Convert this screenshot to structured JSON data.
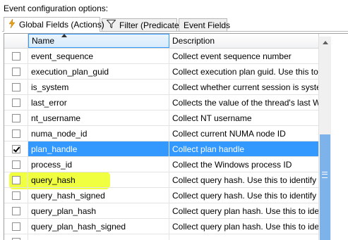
{
  "caption": "Event configuration options:",
  "tabs": [
    {
      "label": "Global Fields (Actions)",
      "icon": "lightning-icon",
      "active": true
    },
    {
      "label": "Filter (Predicate)",
      "icon": "funnel-icon",
      "active": false
    },
    {
      "label": "Event Fields",
      "icon": "",
      "active": false
    }
  ],
  "grid": {
    "columns": {
      "name": "Name",
      "description": "Description"
    },
    "rows": [
      {
        "name": "event_sequence",
        "description": "Collect event sequence number",
        "checked": false
      },
      {
        "name": "execution_plan_guid",
        "description": "Collect execution plan guid. Use this to uniqu",
        "checked": false
      },
      {
        "name": "is_system",
        "description": "Collect whether current session is system",
        "checked": false
      },
      {
        "name": "last_error",
        "description": "Collects the value of the thread's last Windo",
        "checked": false
      },
      {
        "name": "nt_username",
        "description": "Collect NT username",
        "checked": false
      },
      {
        "name": "numa_node_id",
        "description": "Collect current NUMA node ID",
        "checked": false
      },
      {
        "name": "plan_handle",
        "description": "Collect plan handle",
        "checked": true
      },
      {
        "name": "process_id",
        "description": "Collect the Windows process ID",
        "checked": false
      },
      {
        "name": "query_hash",
        "description": "Collect query hash. Use this to identify querie",
        "checked": false
      },
      {
        "name": "query_hash_signed",
        "description": "Collect query hash. Use this to identify querie",
        "checked": false
      },
      {
        "name": "query_plan_hash",
        "description": "Collect query plan hash. Use this to identify s",
        "checked": false
      },
      {
        "name": "query_plan_hash_signed",
        "description": "Collect query plan hash. Use this to identify s",
        "checked": false
      },
      {
        "name": "",
        "description": "",
        "checked": false
      }
    ]
  },
  "colors": {
    "selection": "#3399ff",
    "highlighter": "#ebff00",
    "scroll_thumb": "#7db2ea"
  }
}
